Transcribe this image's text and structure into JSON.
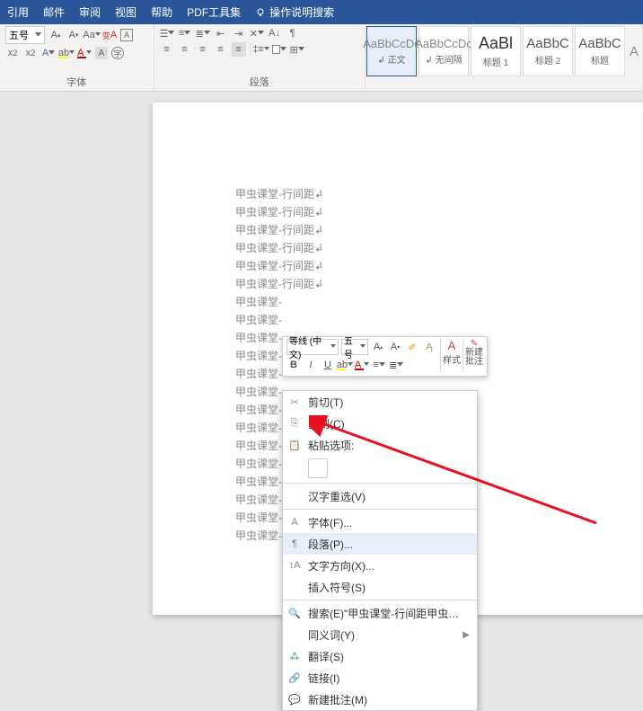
{
  "menubar": {
    "items": [
      "引用",
      "邮件",
      "审阅",
      "视图",
      "帮助",
      "PDF工具集"
    ],
    "search_hint": "操作说明搜索"
  },
  "ribbon": {
    "font": {
      "size_value": "五号",
      "group_label": "字体"
    },
    "paragraph": {
      "group_label": "段落"
    },
    "styles": [
      {
        "preview": "AaBbCcDc",
        "name": "↲ 正文"
      },
      {
        "preview": "AaBbCcDc",
        "name": "↲ 无间隔"
      },
      {
        "preview": "AaBl",
        "name": "标题 1"
      },
      {
        "preview": "AaBbC",
        "name": "标题 2"
      },
      {
        "preview": "AaBbC",
        "name": "标题"
      }
    ]
  },
  "document": {
    "line_text": "甲虫课堂-行间距↲",
    "line_text_cut": "甲虫课堂-",
    "line_count": 20
  },
  "mini_toolbar": {
    "font_combo": "等线 (中文)",
    "size_combo": "五号",
    "style_btn": "样式",
    "new_comment": "新建\n批注"
  },
  "context_menu": {
    "cut": "剪切(T)",
    "copy": "复制(C)",
    "paste_options_label": "粘贴选项:",
    "hanzi": "汉字重选(V)",
    "font": "字体(F)...",
    "paragraph": "段落(P)...",
    "text_direction": "文字方向(X)...",
    "insert_symbol": "插入符号(S)",
    "search": "搜索(E)\"甲虫课堂-行间距甲虫课堂-行...\"",
    "synonym": "同义词(Y)",
    "translate": "翻译(S)",
    "link": "链接(I)",
    "new_comment": "新建批注(M)"
  }
}
